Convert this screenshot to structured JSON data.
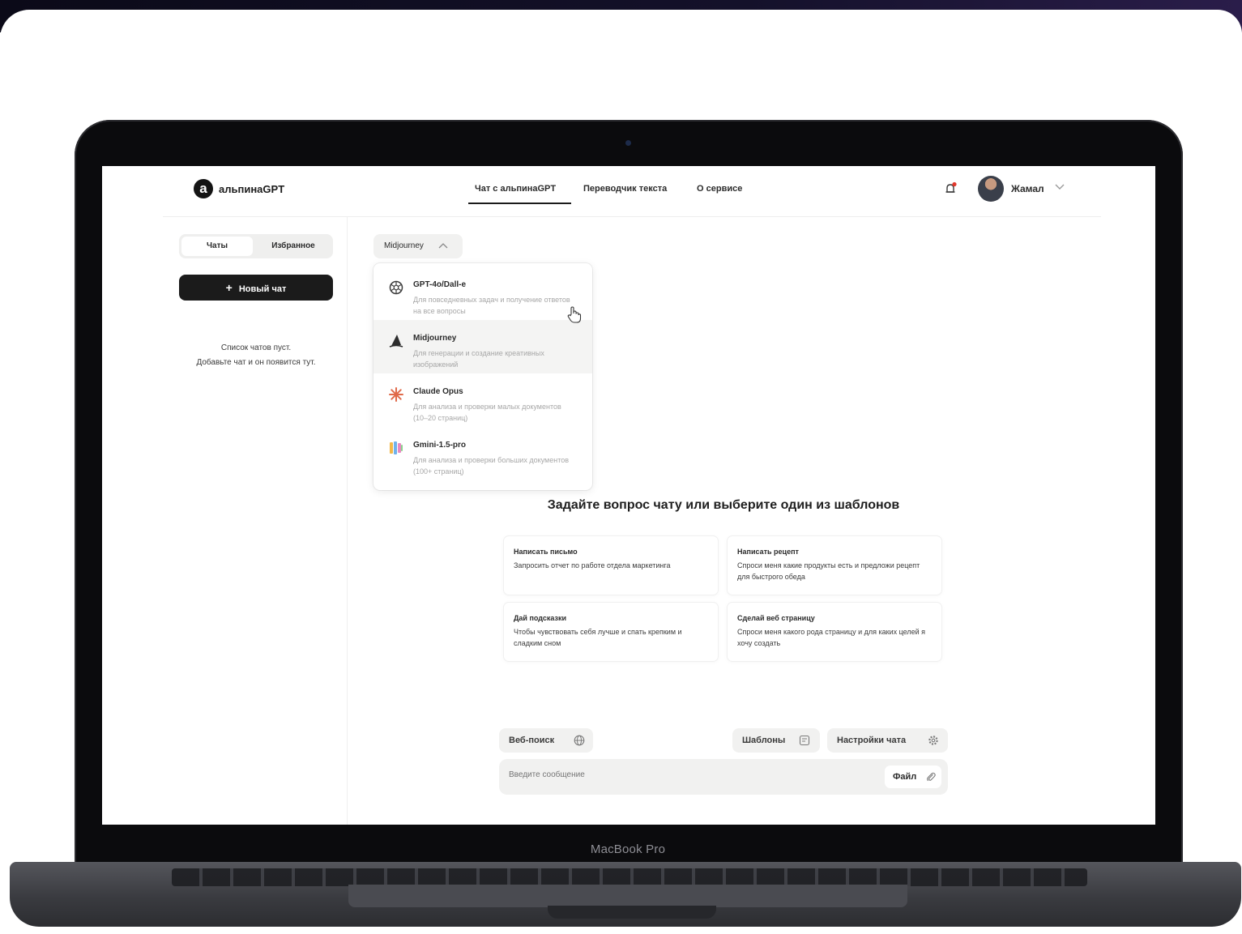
{
  "app": {
    "logo_letter": "a",
    "logo_text": "альпинаGPT"
  },
  "nav": {
    "items": [
      "Чат с альпинаGPT",
      "Переводчик текста",
      "О сервисе"
    ],
    "active_index": 0
  },
  "user": {
    "name": "Жамал"
  },
  "sidebar": {
    "tabs": [
      "Чаты",
      "Избранное"
    ],
    "active_tab": 0,
    "new_chat_label": "Новый чат",
    "empty_line1": "Список чатов пуст.",
    "empty_line2": "Добавьте чат и он появится тут."
  },
  "model_selector": {
    "selected": "Midjourney",
    "options": [
      {
        "name": "GPT-4o/Dall-e",
        "description": "Для повседневных задач и получение ответов на все вопросы",
        "icon": "openai-icon"
      },
      {
        "name": "Midjourney",
        "description": "Для генерации и создание креативных изображений",
        "icon": "midjourney-sail-icon"
      },
      {
        "name": "Claude Opus",
        "description": "Для анализа и проверки малых документов (10–20 страниц)",
        "icon": "claude-burst-icon"
      },
      {
        "name": "Gmini-1.5-pro",
        "description": "Для анализа и проверки больших документов (100+ страниц)",
        "icon": "gemini-icon"
      }
    ],
    "highlighted_index": 1
  },
  "main": {
    "title": "Задайте вопрос чату или выберите один из шаблонов",
    "templates": [
      {
        "title": "Написать письмо",
        "description": "Запросить отчет по работе отдела маркетинга"
      },
      {
        "title": "Написать рецепт",
        "description": "Спроси меня какие продукты есть и предложи рецепт для быстрого обеда"
      },
      {
        "title": "Дай подсказки",
        "description": "Чтобы чувствовать себя лучше и спать крепким и сладким сном"
      },
      {
        "title": "Сделай веб страницу",
        "description": "Спроси меня какого рода страницу и для каких целей я хочу создать"
      }
    ]
  },
  "toolbar": {
    "web_search": "Веб-поиск",
    "templates": "Шаблоны",
    "chat_settings": "Настройки чата"
  },
  "composer": {
    "placeholder": "Введите сообщение",
    "file_label": "Файл"
  },
  "device": {
    "label": "MacBook Pro"
  }
}
